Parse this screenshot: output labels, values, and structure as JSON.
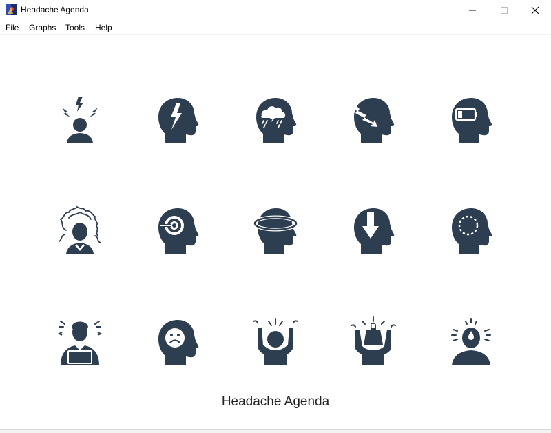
{
  "window": {
    "title": "Headache Agenda",
    "app_icon": "app-logo-icon",
    "controls": [
      "minimize-icon",
      "maximize-icon",
      "close-icon"
    ]
  },
  "menu": {
    "file": "File",
    "graphs": "Graphs",
    "tools": "Tools",
    "help": "Help"
  },
  "icons": [
    {
      "name": "stress-person-lightning-icon"
    },
    {
      "name": "head-lightning-icon"
    },
    {
      "name": "head-storm-cloud-icon"
    },
    {
      "name": "head-migraine-arrow-icon"
    },
    {
      "name": "head-low-battery-icon"
    },
    {
      "name": "person-frazzled-icon"
    },
    {
      "name": "head-target-icon"
    },
    {
      "name": "head-dizzy-orbit-icon"
    },
    {
      "name": "head-down-arrow-icon"
    },
    {
      "name": "head-dashed-circle-icon"
    },
    {
      "name": "person-laptop-stress-icon"
    },
    {
      "name": "head-sad-face-icon"
    },
    {
      "name": "person-holding-head-icon"
    },
    {
      "name": "person-carrying-weight-icon"
    },
    {
      "name": "person-sweat-drop-icon"
    }
  ],
  "footer": {
    "title": "Headache Agenda"
  },
  "colors": {
    "icon": "#2d3e50",
    "background": "#ffffff"
  }
}
